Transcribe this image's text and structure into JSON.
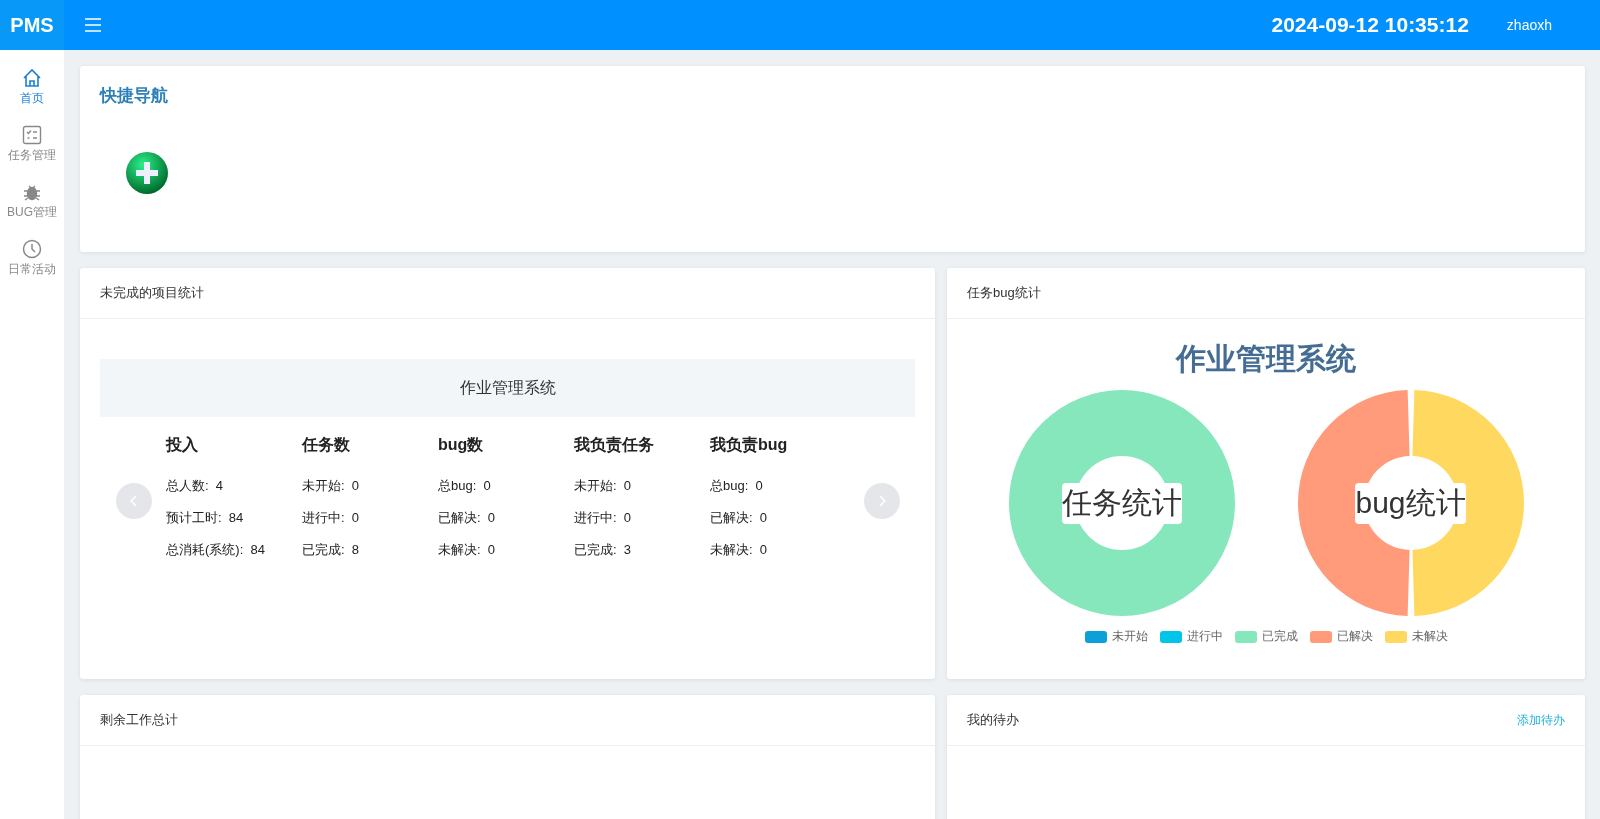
{
  "header": {
    "logo": "PMS",
    "datetime": "2024-09-12 10:35:12",
    "user": "zhaoxh"
  },
  "sidebar": {
    "items": [
      {
        "label": "首页",
        "selected": true
      },
      {
        "label": "任务管理",
        "selected": false
      },
      {
        "label": "BUG管理",
        "selected": false
      },
      {
        "label": "日常活动",
        "selected": false
      }
    ]
  },
  "quick_nav": {
    "title": "快捷导航"
  },
  "project_stats": {
    "title": "未完成的项目统计",
    "project": "作业管理系统",
    "columns": [
      {
        "heading": "投入",
        "rows": [
          {
            "label": "总人数:",
            "value": "4"
          },
          {
            "label": "预计工时:",
            "value": "84"
          },
          {
            "label": "总消耗(系统):",
            "value": "84"
          }
        ]
      },
      {
        "heading": "任务数",
        "rows": [
          {
            "label": "未开始:",
            "value": "0"
          },
          {
            "label": "进行中:",
            "value": "0"
          },
          {
            "label": "已完成:",
            "value": "8"
          }
        ]
      },
      {
        "heading": "bug数",
        "rows": [
          {
            "label": "总bug:",
            "value": "0"
          },
          {
            "label": "已解决:",
            "value": "0"
          },
          {
            "label": "未解决:",
            "value": "0"
          }
        ]
      },
      {
        "heading": "我负责任务",
        "rows": [
          {
            "label": "未开始:",
            "value": "0"
          },
          {
            "label": "进行中:",
            "value": "0"
          },
          {
            "label": "已完成:",
            "value": "3"
          }
        ]
      },
      {
        "heading": "我负责bug",
        "rows": [
          {
            "label": "总bug:",
            "value": "0"
          },
          {
            "label": "已解决:",
            "value": "0"
          },
          {
            "label": "未解决:",
            "value": "0"
          }
        ]
      }
    ]
  },
  "task_bug_stats": {
    "title": "任务bug统计",
    "chart_title": "作业管理系统",
    "donuts": [
      {
        "label": "任务统计",
        "kind": "task"
      },
      {
        "label": "bug统计",
        "kind": "bug"
      }
    ],
    "legend": [
      {
        "label": "未开始",
        "color": "#0d9fd8"
      },
      {
        "label": "进行中",
        "color": "#00c5e8"
      },
      {
        "label": "已完成",
        "color": "#86e7bc"
      },
      {
        "label": "已解决",
        "color": "#ff9a7a"
      },
      {
        "label": "未解决",
        "color": "#ffd95f"
      }
    ]
  },
  "remaining_work": {
    "title": "剩余工作总计"
  },
  "todo": {
    "title": "我的待办",
    "action": "添加待办"
  }
}
